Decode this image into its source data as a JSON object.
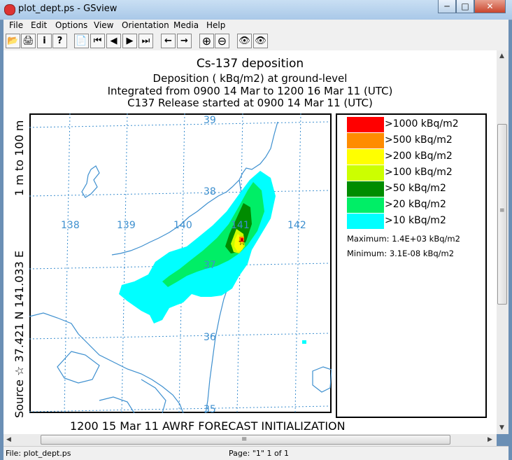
{
  "window": {
    "title": "plot_dept.ps - GSview",
    "min_glyph": "─",
    "max_glyph": "□",
    "close_glyph": "✕"
  },
  "menu": {
    "items": [
      "File",
      "Edit",
      "Options",
      "View",
      "Orientation",
      "Media",
      "Help"
    ]
  },
  "toolbar": {
    "glyphs": [
      "📂",
      "🖨",
      "i",
      "?",
      "📄",
      "⏮",
      "◀",
      "▶",
      "⏭",
      "←",
      "→",
      "⊕",
      "⊖",
      "👁",
      "👁"
    ]
  },
  "plot": {
    "title": "Cs-137 deposition",
    "subtitle1": "Deposition  ( kBq/m2) at ground-level",
    "subtitle2": "Integrated from 0900 14 Mar to 1200 16 Mar 11 (UTC)",
    "subtitle3": "C137 Release started at 0900 14 Mar 11 (UTC)",
    "side_label_1": "Source ☆  37.421  N 141.033  E",
    "side_label_2": "1 m to   100 m",
    "footer": "1200 15 Mar 11 AWRF FORECAST INITIALIZATION",
    "lat_labels": [
      "39",
      "38",
      "37",
      "36",
      "35"
    ],
    "lon_labels": [
      "138",
      "139",
      "140",
      "141",
      "142"
    ],
    "legend": [
      {
        "label": ">1000  kBq/m2",
        "color": "#ff0000"
      },
      {
        "label": ">500  kBq/m2",
        "color": "#ff8c00"
      },
      {
        "label": ">200  kBq/m2",
        "color": "#ffff00"
      },
      {
        "label": ">100  kBq/m2",
        "color": "#ccff00"
      },
      {
        "label": ">50  kBq/m2",
        "color": "#008c00"
      },
      {
        "label": ">20  kBq/m2",
        "color": "#00ee66"
      },
      {
        "label": ">10  kBq/m2",
        "color": "#00ffff"
      }
    ],
    "maximum": "Maximum: 1.4E+03  kBq/m2",
    "minimum": "Minimum: 3.1E-08  kBq/m2"
  },
  "scroll": {
    "up": "▲",
    "down": "▼",
    "left": "◀",
    "right": "▶",
    "grip": "≡"
  },
  "status": {
    "file": "File: plot_dept.ps",
    "page": "Page: \"1\"  1 of 1"
  },
  "colors": {
    "water": "#3d8fcf",
    "grid": "#3d8fcf",
    "label": "#3d8fcf"
  }
}
